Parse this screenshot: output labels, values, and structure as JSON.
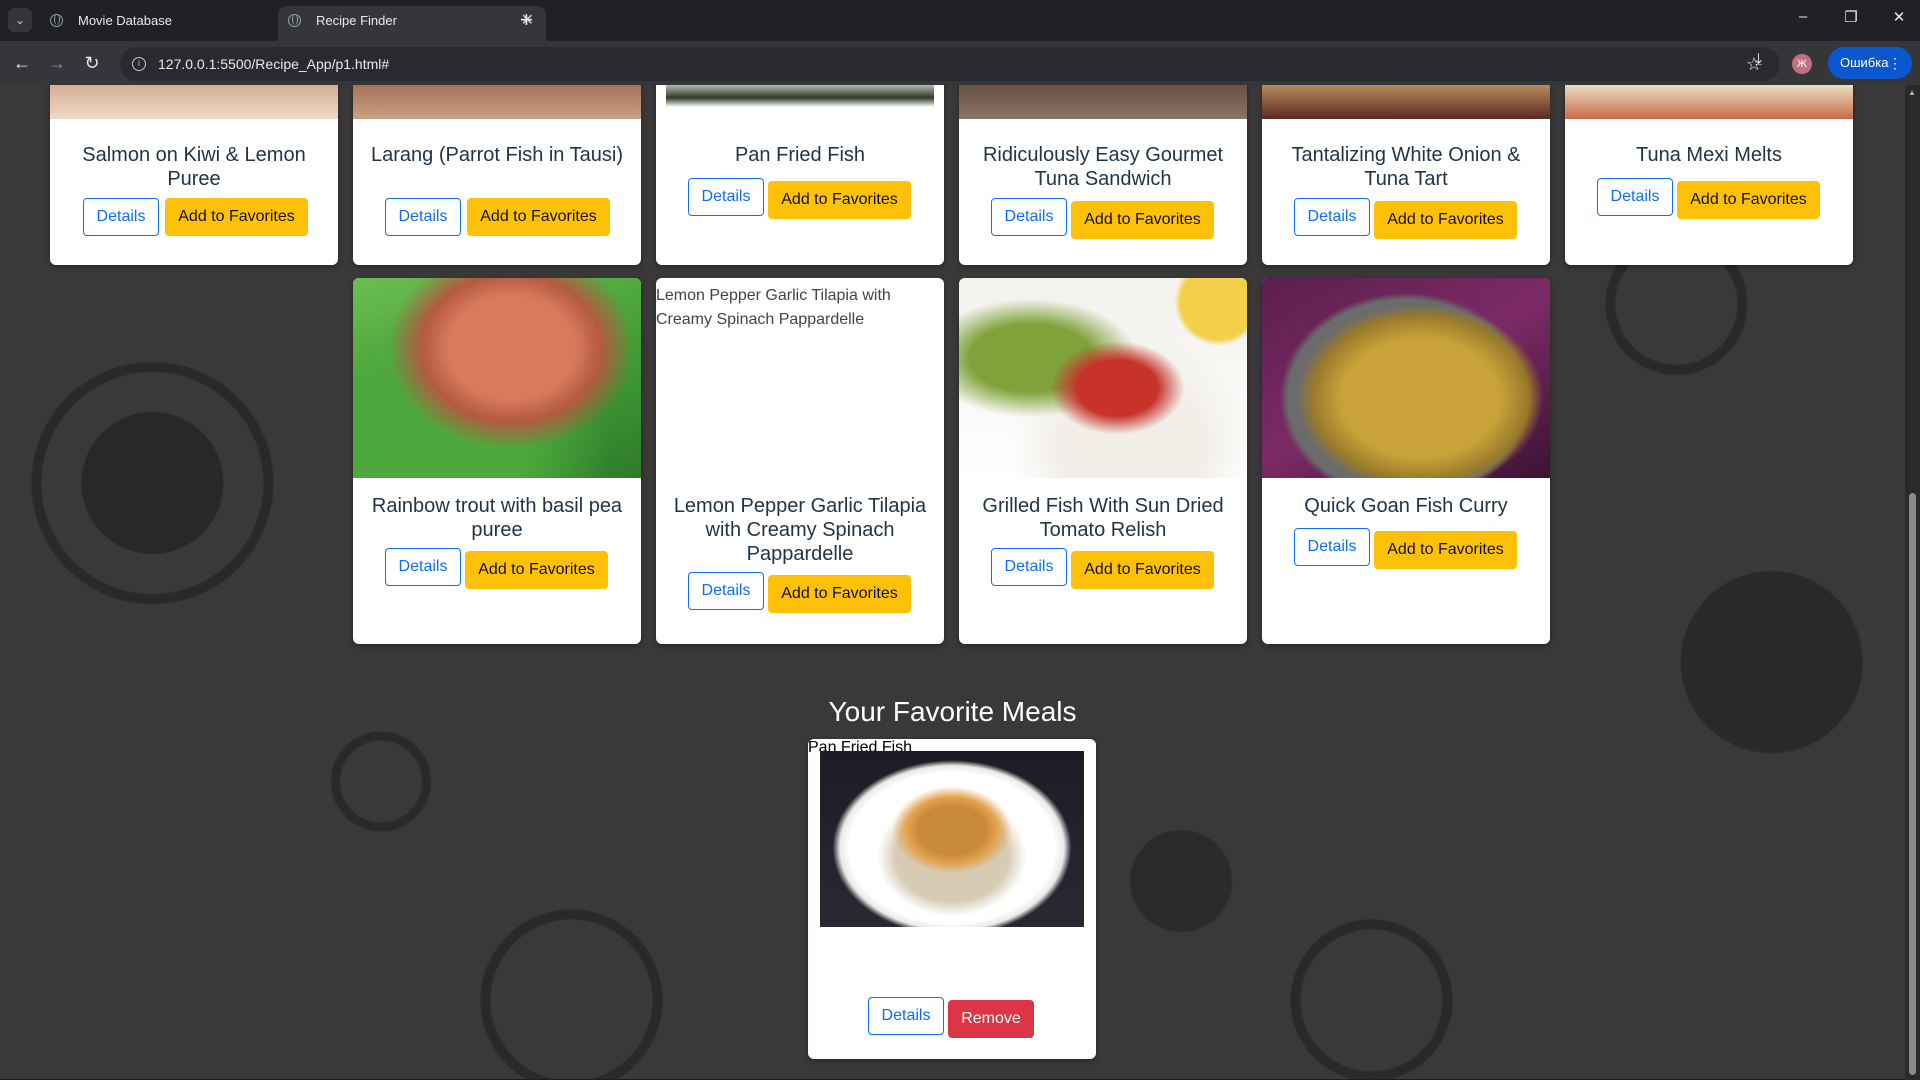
{
  "browser": {
    "tabs": [
      {
        "title": "Movie Database",
        "active": false
      },
      {
        "title": "Recipe Finder",
        "active": true
      }
    ],
    "url": "127.0.0.1:5500/Recipe_App/p1.html#",
    "profile_initial": "Ж",
    "error_label": "Ошибка"
  },
  "buttons": {
    "details": "Details",
    "add_favorite": "Add to Favorites",
    "remove": "Remove"
  },
  "meals_row1": [
    {
      "title": "Salmon on Kiwi & Lemon Puree"
    },
    {
      "title": "Larang (Parrot Fish in Tausi)"
    },
    {
      "title": "Pan Fried Fish"
    },
    {
      "title": "Ridiculously Easy Gourmet Tuna Sandwich"
    },
    {
      "title": "Tantalizing White Onion & Tuna Tart"
    },
    {
      "title": "Tuna Mexi Melts"
    }
  ],
  "meals_row2": [
    {
      "title": "Rainbow trout with basil pea puree"
    },
    {
      "title": "Lemon Pepper Garlic Tilapia with Creamy Spinach Pappardelle",
      "image_alt": "Lemon Pepper Garlic Tilapia with Creamy Spinach Pappardelle"
    },
    {
      "title": "Grilled Fish With Sun Dried Tomato Relish"
    },
    {
      "title": "Quick Goan Fish Curry"
    }
  ],
  "favorites": {
    "heading": "Your Favorite Meals",
    "items": [
      {
        "title": "Pan Fried Fish"
      }
    ]
  },
  "colors": {
    "primary": "#0d6efd",
    "warning": "#ffc107",
    "danger": "#dc3545",
    "title_text": "#213547"
  }
}
